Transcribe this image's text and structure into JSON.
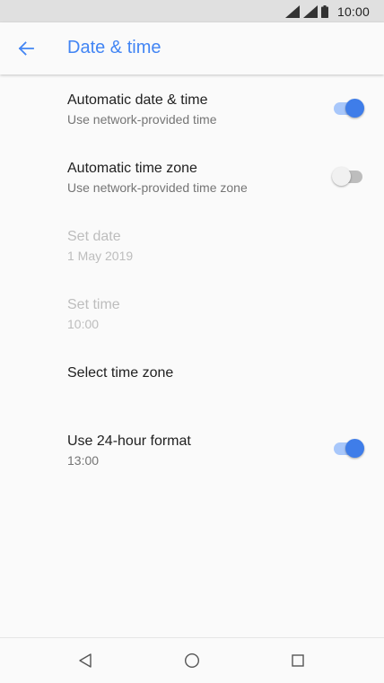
{
  "status_bar": {
    "time": "10:00",
    "icons": [
      "wifi-signal-icon",
      "cell-signal-icon",
      "battery-icon"
    ]
  },
  "app_bar": {
    "title": "Date & time",
    "back_icon": "arrow-left-icon"
  },
  "colors": {
    "accent": "#4285f4",
    "toggle_thumb_on": "#3f7de9",
    "toggle_track_on": "#a8c7fa",
    "text_primary": "#212121",
    "text_secondary": "#757575",
    "text_disabled": "#bdbdbd",
    "status_bar_bg": "#e0e0e0",
    "background": "#fafafa"
  },
  "settings": {
    "automatic_date_time": {
      "title": "Automatic date & time",
      "summary": "Use network-provided time",
      "toggle": "on"
    },
    "automatic_time_zone": {
      "title": "Automatic time zone",
      "summary": "Use network-provided time zone",
      "toggle": "off"
    },
    "set_date": {
      "title": "Set date",
      "summary": "1 May 2019",
      "enabled": false
    },
    "set_time": {
      "title": "Set time",
      "summary": "10:00",
      "enabled": false
    },
    "select_time_zone": {
      "title": "Select time zone"
    },
    "use_24_hour_format": {
      "title": "Use 24-hour format",
      "summary": "13:00",
      "toggle": "on"
    }
  },
  "nav_bar": {
    "buttons": [
      "back-triangle-icon",
      "home-circle-icon",
      "recents-square-icon"
    ]
  }
}
